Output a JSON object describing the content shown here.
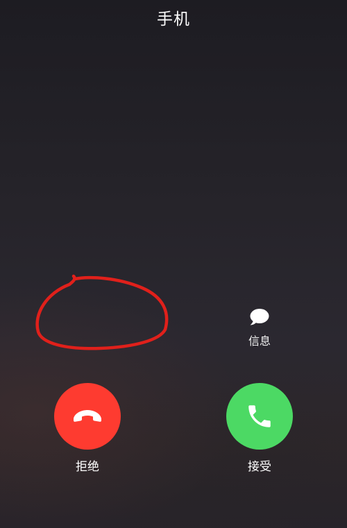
{
  "call": {
    "caller_name": "手机"
  },
  "actions": {
    "message_label": "信息",
    "decline_label": "拒绝",
    "accept_label": "接受"
  },
  "colors": {
    "decline": "#fe3b30",
    "accept": "#4cd964",
    "annotation": "#e0201b"
  },
  "icons": {
    "message": "speech-bubble-icon",
    "decline": "phone-hangup-icon",
    "accept": "phone-icon"
  }
}
